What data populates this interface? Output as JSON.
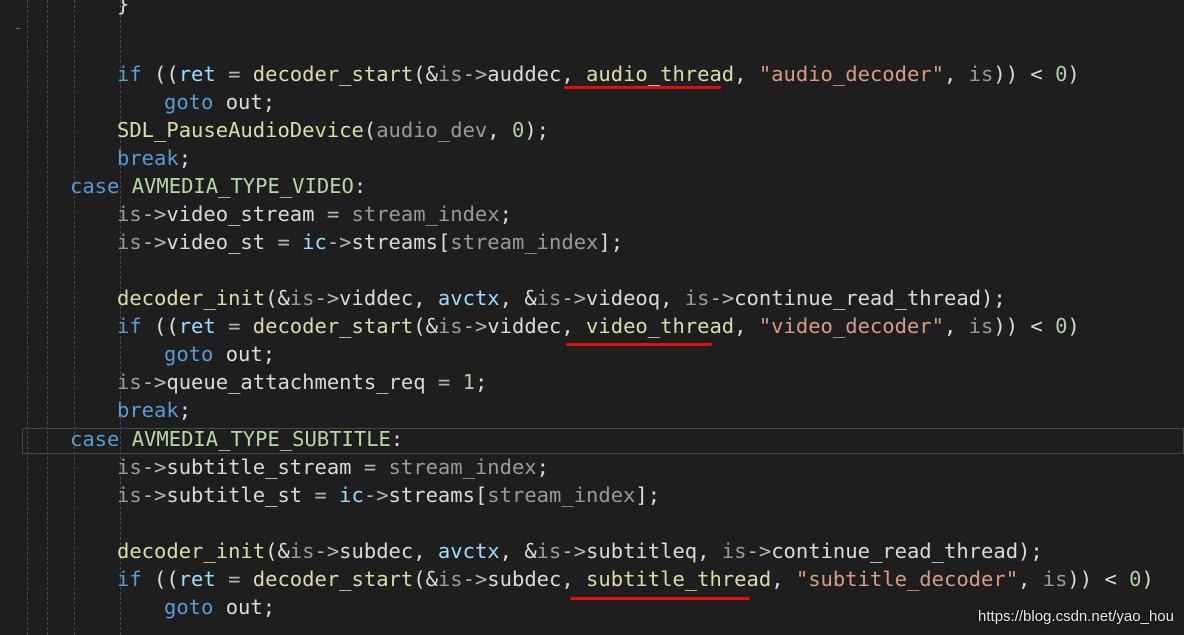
{
  "code": {
    "lines": [
      [
        {
          "t": "}",
          "c": "pl"
        }
      ],
      [],
      [
        {
          "t": "if",
          "c": "kw"
        },
        {
          "t": " ((",
          "c": "pl"
        },
        {
          "t": "ret",
          "c": "var"
        },
        {
          "t": " = ",
          "c": "op"
        },
        {
          "t": "decoder_start",
          "c": "fn"
        },
        {
          "t": "(&",
          "c": "pl"
        },
        {
          "t": "is",
          "c": "par"
        },
        {
          "t": "->",
          "c": "op"
        },
        {
          "t": "auddec",
          "c": "mem"
        },
        {
          "t": ", ",
          "c": "pl"
        },
        {
          "t": "audio_thread",
          "c": "fn"
        },
        {
          "t": ", ",
          "c": "pl"
        },
        {
          "t": "\"audio_decoder\"",
          "c": "str"
        },
        {
          "t": ", ",
          "c": "pl"
        },
        {
          "t": "is",
          "c": "par"
        },
        {
          "t": ")) < ",
          "c": "pl"
        },
        {
          "t": "0",
          "c": "num"
        },
        {
          "t": ")",
          "c": "pl"
        }
      ],
      [
        {
          "t": "goto",
          "c": "kw"
        },
        {
          "t": " out;",
          "c": "pl"
        }
      ],
      [
        {
          "t": "SDL_PauseAudioDevice",
          "c": "fn"
        },
        {
          "t": "(",
          "c": "pl"
        },
        {
          "t": "audio_dev",
          "c": "par"
        },
        {
          "t": ", ",
          "c": "pl"
        },
        {
          "t": "0",
          "c": "num"
        },
        {
          "t": ");",
          "c": "pl"
        }
      ],
      [
        {
          "t": "break",
          "c": "kw"
        },
        {
          "t": ";",
          "c": "pl"
        }
      ],
      [
        {
          "t": "case",
          "c": "kw"
        },
        {
          "t": " ",
          "c": "pl"
        },
        {
          "t": "AVMEDIA_TYPE_VIDEO",
          "c": "mac"
        },
        {
          "t": ":",
          "c": "pl"
        }
      ],
      [
        {
          "t": "is",
          "c": "par"
        },
        {
          "t": "->",
          "c": "op"
        },
        {
          "t": "video_stream",
          "c": "mem"
        },
        {
          "t": " = ",
          "c": "op"
        },
        {
          "t": "stream_index",
          "c": "par"
        },
        {
          "t": ";",
          "c": "pl"
        }
      ],
      [
        {
          "t": "is",
          "c": "par"
        },
        {
          "t": "->",
          "c": "op"
        },
        {
          "t": "video_st",
          "c": "mem"
        },
        {
          "t": " = ",
          "c": "op"
        },
        {
          "t": "ic",
          "c": "var"
        },
        {
          "t": "->",
          "c": "op"
        },
        {
          "t": "streams",
          "c": "mem"
        },
        {
          "t": "[",
          "c": "pl"
        },
        {
          "t": "stream_index",
          "c": "par"
        },
        {
          "t": "];",
          "c": "pl"
        }
      ],
      [],
      [
        {
          "t": "decoder_init",
          "c": "fn"
        },
        {
          "t": "(&",
          "c": "pl"
        },
        {
          "t": "is",
          "c": "par"
        },
        {
          "t": "->",
          "c": "op"
        },
        {
          "t": "viddec",
          "c": "mem"
        },
        {
          "t": ", ",
          "c": "pl"
        },
        {
          "t": "avctx",
          "c": "var"
        },
        {
          "t": ", &",
          "c": "pl"
        },
        {
          "t": "is",
          "c": "par"
        },
        {
          "t": "->",
          "c": "op"
        },
        {
          "t": "videoq",
          "c": "mem"
        },
        {
          "t": ", ",
          "c": "pl"
        },
        {
          "t": "is",
          "c": "par"
        },
        {
          "t": "->",
          "c": "op"
        },
        {
          "t": "continue_read_thread",
          "c": "mem"
        },
        {
          "t": ");",
          "c": "pl"
        }
      ],
      [
        {
          "t": "if",
          "c": "kw"
        },
        {
          "t": " ((",
          "c": "pl"
        },
        {
          "t": "ret",
          "c": "var"
        },
        {
          "t": " = ",
          "c": "op"
        },
        {
          "t": "decoder_start",
          "c": "fn"
        },
        {
          "t": "(&",
          "c": "pl"
        },
        {
          "t": "is",
          "c": "par"
        },
        {
          "t": "->",
          "c": "op"
        },
        {
          "t": "viddec",
          "c": "mem"
        },
        {
          "t": ", ",
          "c": "pl"
        },
        {
          "t": "video_thread",
          "c": "fn"
        },
        {
          "t": ", ",
          "c": "pl"
        },
        {
          "t": "\"video_decoder\"",
          "c": "str"
        },
        {
          "t": ", ",
          "c": "pl"
        },
        {
          "t": "is",
          "c": "par"
        },
        {
          "t": ")) < ",
          "c": "pl"
        },
        {
          "t": "0",
          "c": "num"
        },
        {
          "t": ")",
          "c": "pl"
        }
      ],
      [
        {
          "t": "goto",
          "c": "kw"
        },
        {
          "t": " out;",
          "c": "pl"
        }
      ],
      [
        {
          "t": "is",
          "c": "par"
        },
        {
          "t": "->",
          "c": "op"
        },
        {
          "t": "queue_attachments_req",
          "c": "mem"
        },
        {
          "t": " = ",
          "c": "op"
        },
        {
          "t": "1",
          "c": "num"
        },
        {
          "t": ";",
          "c": "pl"
        }
      ],
      [
        {
          "t": "break",
          "c": "kw"
        },
        {
          "t": ";",
          "c": "pl"
        }
      ],
      [
        {
          "t": "case",
          "c": "kw"
        },
        {
          "t": " ",
          "c": "pl"
        },
        {
          "t": "AVMEDIA_TYPE_SUBTITLE",
          "c": "mac"
        },
        {
          "t": ":",
          "c": "pl"
        }
      ],
      [
        {
          "t": "is",
          "c": "par"
        },
        {
          "t": "->",
          "c": "op"
        },
        {
          "t": "subtitle_stream",
          "c": "mem"
        },
        {
          "t": " = ",
          "c": "op"
        },
        {
          "t": "stream_index",
          "c": "par"
        },
        {
          "t": ";",
          "c": "pl"
        }
      ],
      [
        {
          "t": "is",
          "c": "par"
        },
        {
          "t": "->",
          "c": "op"
        },
        {
          "t": "subtitle_st",
          "c": "mem"
        },
        {
          "t": " = ",
          "c": "op"
        },
        {
          "t": "ic",
          "c": "var"
        },
        {
          "t": "->",
          "c": "op"
        },
        {
          "t": "streams",
          "c": "mem"
        },
        {
          "t": "[",
          "c": "pl"
        },
        {
          "t": "stream_index",
          "c": "par"
        },
        {
          "t": "];",
          "c": "pl"
        }
      ],
      [],
      [
        {
          "t": "decoder_init",
          "c": "fn"
        },
        {
          "t": "(&",
          "c": "pl"
        },
        {
          "t": "is",
          "c": "par"
        },
        {
          "t": "->",
          "c": "op"
        },
        {
          "t": "subdec",
          "c": "mem"
        },
        {
          "t": ", ",
          "c": "pl"
        },
        {
          "t": "avctx",
          "c": "var"
        },
        {
          "t": ", &",
          "c": "pl"
        },
        {
          "t": "is",
          "c": "par"
        },
        {
          "t": "->",
          "c": "op"
        },
        {
          "t": "subtitleq",
          "c": "mem"
        },
        {
          "t": ", ",
          "c": "pl"
        },
        {
          "t": "is",
          "c": "par"
        },
        {
          "t": "->",
          "c": "op"
        },
        {
          "t": "continue_read_thread",
          "c": "mem"
        },
        {
          "t": ");",
          "c": "pl"
        }
      ],
      [
        {
          "t": "if",
          "c": "kw"
        },
        {
          "t": " ((",
          "c": "pl"
        },
        {
          "t": "ret",
          "c": "var"
        },
        {
          "t": " = ",
          "c": "op"
        },
        {
          "t": "decoder_start",
          "c": "fn"
        },
        {
          "t": "(&",
          "c": "pl"
        },
        {
          "t": "is",
          "c": "par"
        },
        {
          "t": "->",
          "c": "op"
        },
        {
          "t": "subdec",
          "c": "mem"
        },
        {
          "t": ", ",
          "c": "pl"
        },
        {
          "t": "subtitle_thread",
          "c": "fn"
        },
        {
          "t": ", ",
          "c": "pl"
        },
        {
          "t": "\"subtitle_decoder\"",
          "c": "str"
        },
        {
          "t": ", ",
          "c": "pl"
        },
        {
          "t": "is",
          "c": "par"
        },
        {
          "t": ")) < ",
          "c": "pl"
        },
        {
          "t": "0",
          "c": "num"
        },
        {
          "t": ")",
          "c": "pl"
        }
      ],
      [
        {
          "t": "goto",
          "c": "kw"
        },
        {
          "t": " out;",
          "c": "pl"
        }
      ]
    ]
  },
  "annotation": {
    "underline_color": "#e01010",
    "underlined_tokens": [
      "audio_thread",
      "video_thread",
      "subtitle_thread"
    ]
  },
  "watermark": "https://blog.csdn.net/yao_hou",
  "colors": {
    "background": "#1e1e1e",
    "keyword": "#569cd6",
    "function": "#dcdcaa",
    "macro": "#b8d7a3",
    "string": "#d69d85",
    "number": "#b5cea8"
  }
}
